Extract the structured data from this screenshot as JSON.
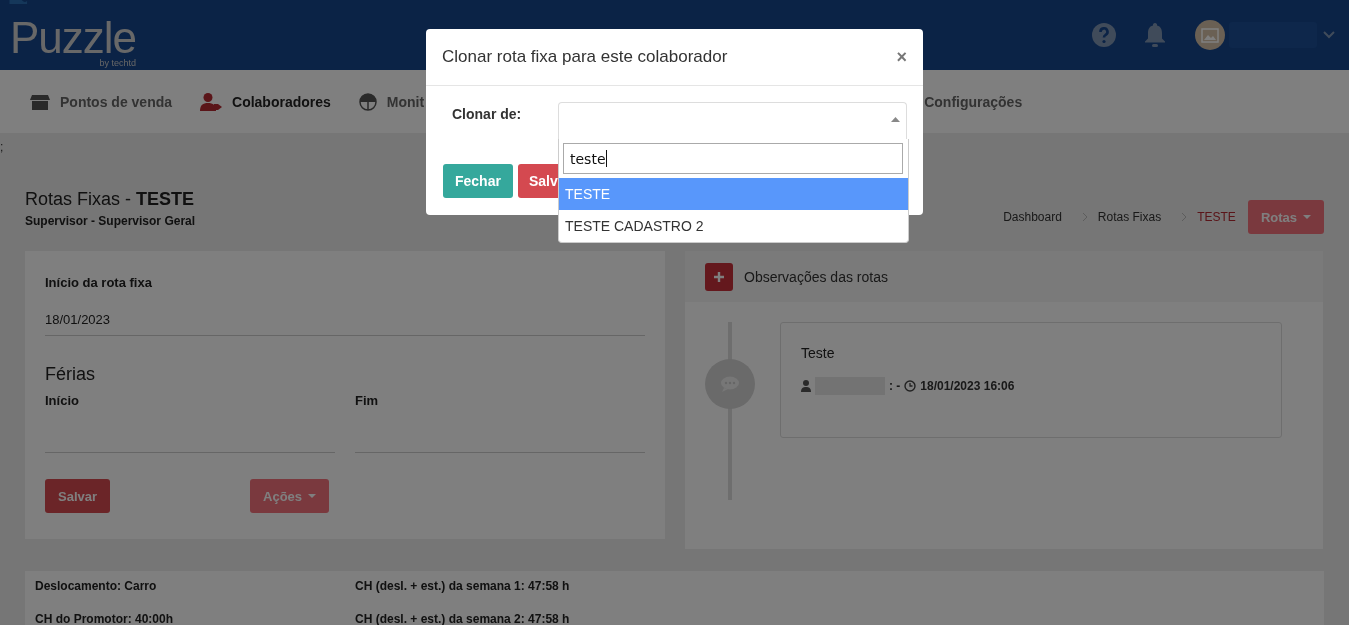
{
  "header": {
    "logo": "Puzzle",
    "logo_sub": "by techtd"
  },
  "nav": [
    {
      "label": "Pontos de venda",
      "selected": false
    },
    {
      "label": "Colaboradores",
      "selected": true
    },
    {
      "label": "Monit",
      "selected": false
    },
    {
      "label": "Configurações",
      "selected": false
    }
  ],
  "stray_text": ";",
  "page": {
    "title": "Rotas Fixas - **TESTE**",
    "subtitle": "Supervisor - Supervisor Geral",
    "breadcrumbs": [
      {
        "label": "Dashboard",
        "current": false
      },
      {
        "label": "Rotas Fixas",
        "current": false
      },
      {
        "label": "TESTE",
        "current": true
      }
    ],
    "menu_button": "Rotas"
  },
  "route_form": {
    "start_label": "Início da rota fixa",
    "start_value": "18/01/2023",
    "vacation_title": "Férias",
    "vacation_start_label": "Início",
    "vacation_end_label": "Fim",
    "save_button": "Salvar",
    "actions_button": "Ações"
  },
  "notes": {
    "title": "Observações das rotas",
    "items": [
      {
        "text": "Teste",
        "author_sep": ": -",
        "datetime": "18/01/2023 16:06"
      }
    ]
  },
  "summary": {
    "left": [
      "Deslocamento: Carro",
      "CH do Promotor: 40:00h"
    ],
    "right": [
      "CH (desl. + est.) da semana 1: 47:58 h",
      "CH (desl. + est.) da semana 2: 47:58 h"
    ]
  },
  "modal": {
    "title": "Clonar rota fixa para este colaborador",
    "close": "×",
    "field_label": "Clonar de:",
    "search_value": "teste",
    "options": [
      {
        "label": "TESTE",
        "selected": true
      },
      {
        "label": "TESTE CADASTRO 2",
        "selected": false
      }
    ],
    "buttons": [
      {
        "label": "Fechar",
        "kind": "close"
      },
      {
        "label": "Salv",
        "kind": "save"
      }
    ]
  }
}
